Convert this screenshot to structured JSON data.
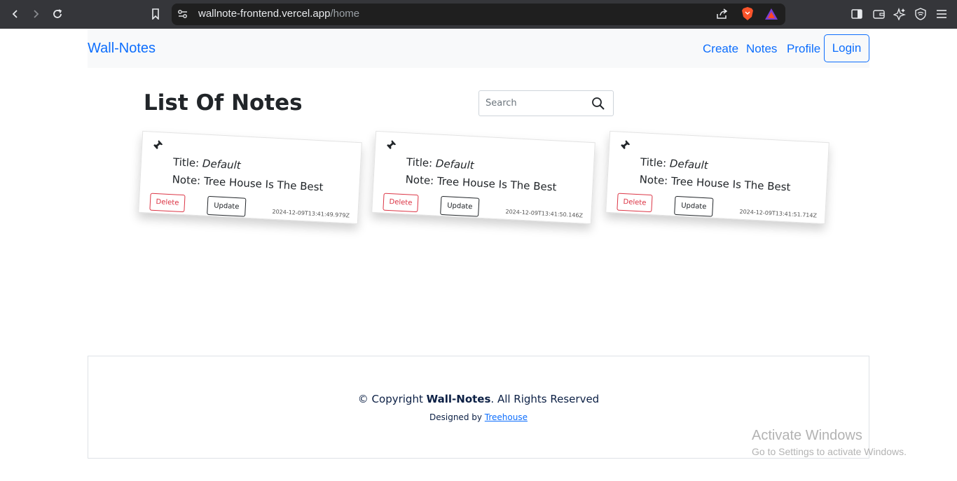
{
  "browser": {
    "url_host": "wallnote-frontend.vercel.app",
    "url_path": "/home",
    "icons": [
      "back-arrow-icon",
      "forward-arrow-icon",
      "reload-icon",
      "bookmark-icon",
      "site-settings-icon",
      "share-icon",
      "brave-shields-icon",
      "brave-rewards-icon",
      "sidebar-icon",
      "wallet-icon",
      "leo-ai-icon",
      "vpn-icon",
      "menu-icon"
    ]
  },
  "navbar": {
    "brand": "Wall-Notes",
    "links": [
      "Create",
      "Notes",
      "Profile"
    ],
    "login_label": "Login"
  },
  "main": {
    "title": "List Of Notes",
    "search_placeholder": "Search"
  },
  "notes": [
    {
      "title_label": "Title:",
      "title_value": "Default",
      "note_label": "Note:",
      "note_value": "Tree House Is The Best",
      "delete_label": "Delete",
      "update_label": "Update",
      "timestamp": "2024-12-09T13:41:49.979Z"
    },
    {
      "title_label": "Title:",
      "title_value": "Default",
      "note_label": "Note:",
      "note_value": "Tree House Is The Best",
      "delete_label": "Delete",
      "update_label": "Update",
      "timestamp": "2024-12-09T13:41:50.146Z"
    },
    {
      "title_label": "Title:",
      "title_value": "Default",
      "note_label": "Note:",
      "note_value": "Tree House Is The Best",
      "delete_label": "Delete",
      "update_label": "Update",
      "timestamp": "2024-12-09T13:41:51.714Z"
    }
  ],
  "footer": {
    "copyright_prefix": "© Copyright ",
    "copyright_brand": "Wall-Notes",
    "copyright_suffix": ". All Rights Reserved",
    "designed_prefix": "Designed by ",
    "designed_link": "Treehouse"
  },
  "watermark": {
    "line1": "Activate Windows",
    "line2": "Go to Settings to activate Windows."
  },
  "colors": {
    "accent": "#0d6efd",
    "danger": "#dc3545",
    "navbar_bg": "#f8f9fa",
    "chrome_bg": "#35363a"
  }
}
